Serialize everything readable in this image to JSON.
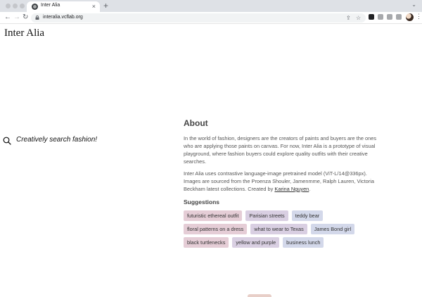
{
  "browser": {
    "tab_title": "Inter Alia",
    "tab_close": "×",
    "new_tab": "+",
    "tab_menu": "⌄",
    "url": "interalia.vcflab.org",
    "back": "←",
    "forward": "→",
    "reload": "↻",
    "share": "⇪",
    "bookmark": "☆",
    "menu": "⋮",
    "extensions": [
      {
        "name": "extension-a-icon",
        "color": "#202124"
      },
      {
        "name": "extension-b-icon",
        "color": "#5f6368"
      },
      {
        "name": "puzzle-icon",
        "color": "#5f6368"
      },
      {
        "name": "sidebar-icon",
        "color": "#5f6368"
      }
    ]
  },
  "page": {
    "brand": "Inter Alia",
    "search": {
      "placeholder": "Creatively search fashion!"
    },
    "about": {
      "heading": "About",
      "para1": "In the world of fashion, designers are the creators of paints and buyers are the ones who are applying those paints on canvas. For now, Inter Alia is a prototype of visual playground, where fashion buyers could explore quality outfits with their creative searches.",
      "para2_prefix": "Inter Alia uses contrastive language-image pretrained model (ViT-L/14@336px). Images are sourced from the Proenza Shouler, Jamenmme, Ralph Lauren, Victoria Beckham latest collections. Created by ",
      "author": "Karina Nguyen",
      "para2_suffix": "."
    },
    "suggestions": {
      "heading": "Suggestions",
      "rows": [
        [
          {
            "label": "futuristic ethereal outfit",
            "color": "#e5cdd6"
          },
          {
            "label": "Parisian streets",
            "color": "#d9cfe2"
          },
          {
            "label": "teddy bear",
            "color": "#d3d8ea"
          }
        ],
        [
          {
            "label": "floral patterns on a dress",
            "color": "#e5cdd6"
          },
          {
            "label": "what to wear to Texas",
            "color": "#d9cfe2"
          },
          {
            "label": "James Bond girl",
            "color": "#d3d8ea"
          }
        ],
        [
          {
            "label": "black turtlenecks",
            "color": "#e5cdd6"
          },
          {
            "label": "yellow and purple",
            "color": "#d9cfe2"
          },
          {
            "label": "business lunch",
            "color": "#d3d8ea"
          }
        ]
      ]
    }
  }
}
